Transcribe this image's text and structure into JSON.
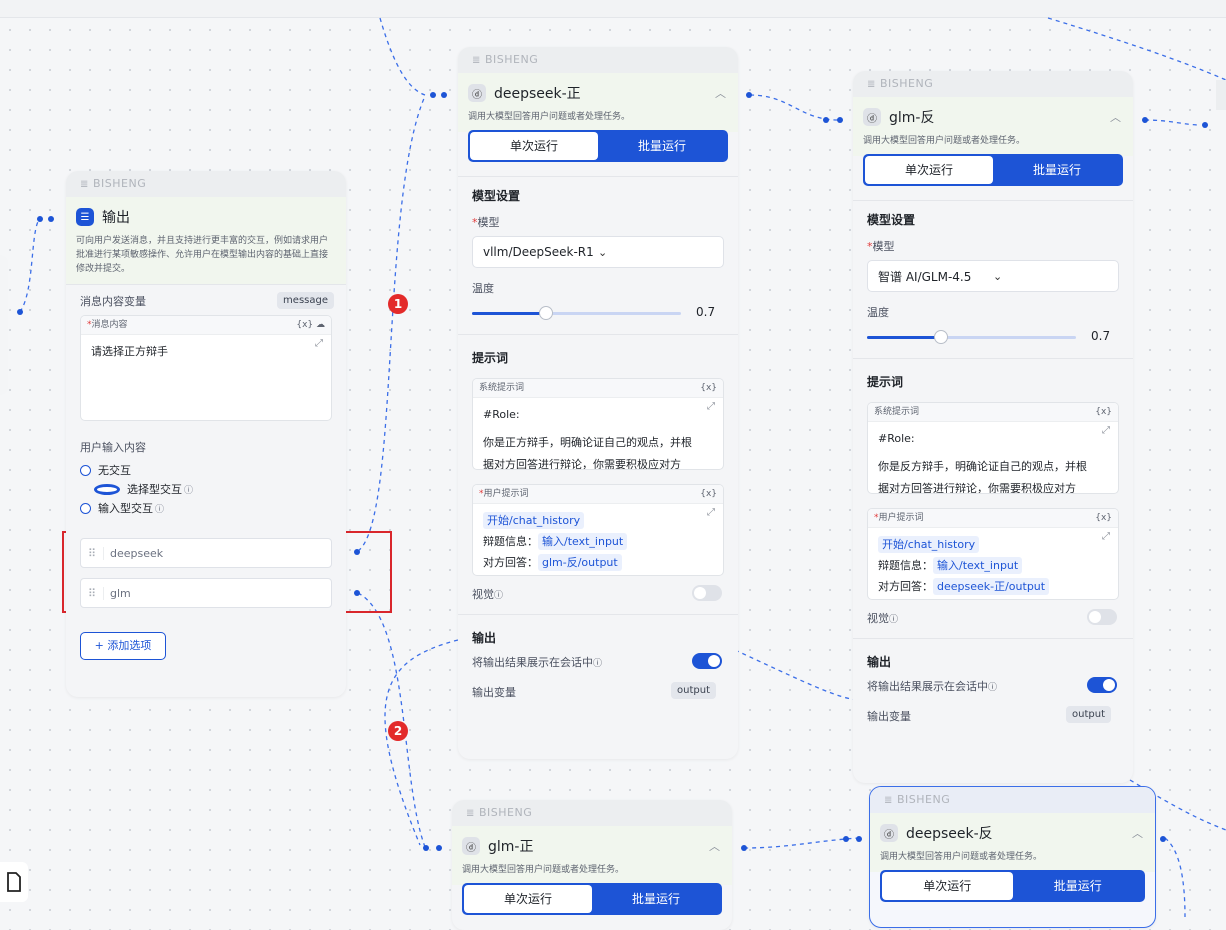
{
  "brand": "BISHENG",
  "node_output": {
    "title": "输出",
    "desc": "可向用户发送消息，并且支持进行更丰富的交互，例如请求用户批准进行某项敏感操作、允许用户在模型输出内容的基础上直接修改并提交。",
    "msg_var_label": "消息内容变量",
    "msg_var_tag": "message",
    "msg_box_label": "消息内容",
    "msg_box_tools": "{x}",
    "msg_text": "请选择正方辩手",
    "user_input_label": "用户输入内容",
    "radios": [
      "无交互",
      "选择型交互",
      "输入型交互"
    ],
    "selected_radio": 1,
    "options": [
      "deepseek",
      "glm"
    ],
    "add_option": "+ 添加选项"
  },
  "llm_nodes": [
    {
      "title": "deepseek-正",
      "desc": "调用大模型回答用户问题或者处理任务。",
      "tab_single": "单次运行",
      "tab_batch": "批量运行",
      "model_section": "模型设置",
      "model_label": "模型",
      "model_value": "vllm/DeepSeek-R1",
      "temp_label": "温度",
      "temp_value": "0.7",
      "temp_fraction": 0.35,
      "prompt_section": "提示词",
      "sys_prompt_label": "系统提示词",
      "sys_prompt_line1": "#Role:",
      "sys_prompt_line2": "你是正方辩手，明确论证自己的观点，并根",
      "sys_prompt_line3": "据对方回答进行辩论，你需要积极应对方",
      "user_prompt_label": "用户提示词",
      "chip1": "开始/chat_history",
      "line2_label": "辩题信息：",
      "chip2": "输入/text_input",
      "line3_label": "对方回答：",
      "chip3": "glm-反/output",
      "vision_label": "视觉",
      "vision_on": false,
      "output_section": "输出",
      "show_output_label": "将输出结果展示在会话中",
      "show_output_on": true,
      "output_var_label": "输出变量",
      "output_var_tag": "output"
    },
    {
      "title": "glm-反",
      "desc": "调用大模型回答用户问题或者处理任务。",
      "tab_single": "单次运行",
      "tab_batch": "批量运行",
      "model_section": "模型设置",
      "model_label": "模型",
      "model_value": "智谱 AI/GLM-4.5",
      "temp_label": "温度",
      "temp_value": "0.7",
      "temp_fraction": 0.35,
      "prompt_section": "提示词",
      "sys_prompt_label": "系统提示词",
      "sys_prompt_line1": "#Role:",
      "sys_prompt_line2": "你是反方辩手，明确论证自己的观点，并根",
      "sys_prompt_line3": "据对方回答进行辩论，你需要积极应对方",
      "user_prompt_label": "用户提示词",
      "chip1": "开始/chat_history",
      "line2_label": "辩题信息：",
      "chip2": "输入/text_input",
      "line3_label": "对方回答：",
      "chip3": "deepseek-正/output",
      "vision_label": "视觉",
      "vision_on": false,
      "output_section": "输出",
      "show_output_label": "将输出结果展示在会话中",
      "show_output_on": true,
      "output_var_label": "输出变量",
      "output_var_tag": "output"
    }
  ],
  "bottom_nodes": [
    {
      "title": "glm-正",
      "desc": "调用大模型回答用户问题或者处理任务。",
      "tab_single": "单次运行",
      "tab_batch": "批量运行"
    },
    {
      "title": "deepseek-反",
      "desc": "调用大模型回答用户问题或者处理任务。",
      "tab_single": "单次运行",
      "tab_batch": "批量运行"
    }
  ],
  "badges": [
    "1",
    "2"
  ],
  "colors": {
    "accent": "#1d54d6",
    "badge": "#e32a2a",
    "highlight_box": "#d9262c"
  },
  "icons": {
    "llm": "llm-icon",
    "output": "message-icon",
    "file": "file-icon"
  }
}
